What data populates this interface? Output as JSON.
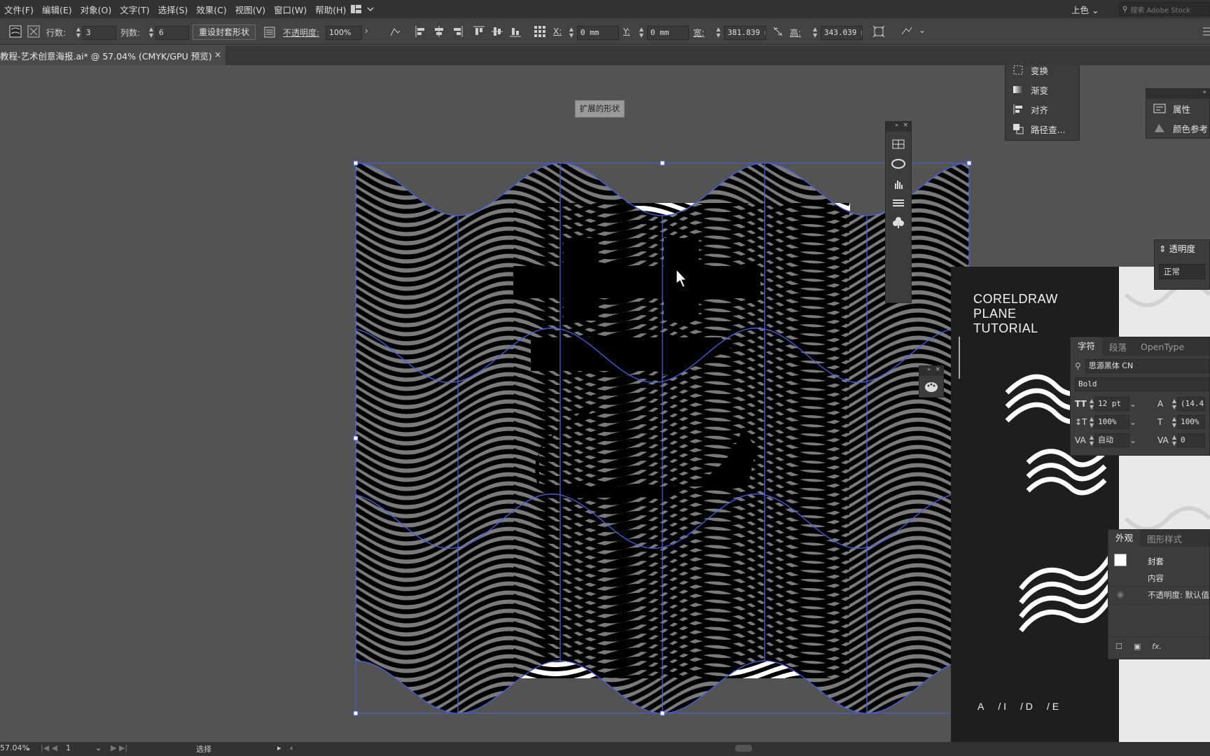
{
  "menu": [
    "文件(F)",
    "编辑(E)",
    "对象(O)",
    "文字(T)",
    "选择(S)",
    "效果(C)",
    "视图(V)",
    "窗口(W)",
    "帮助(H)"
  ],
  "menu_right": {
    "workspace": "上色",
    "search_placeholder": "搜索 Adobe Stock"
  },
  "control": {
    "rows_label": "行数:",
    "rows_value": "3",
    "cols_label": "列数:",
    "cols_value": "6",
    "reset_envelope": "重设封套形状",
    "opacity_label": "不透明度:",
    "opacity_value": "100%",
    "x_label": "X:",
    "x_value": "0 mm",
    "y_label": "Y:",
    "y_value": "0 mm",
    "w_label": "宽:",
    "w_value": "381.839 m",
    "h_label": "高:",
    "h_value": "343.039 m"
  },
  "document_tab": {
    "title": "教程-艺术创意海报.ai* @ 57.04% (CMYK/GPU 预览)",
    "close": "×"
  },
  "tooltip": "扩展的形状",
  "artwork": {
    "glyph": "艺"
  },
  "panel_transform": {
    "items": [
      "变换",
      "渐变",
      "对齐",
      "路径查..."
    ]
  },
  "panel_props": {
    "items": [
      "属性",
      "颜色参考"
    ]
  },
  "poster": {
    "title_lines": [
      "CORELDRAW",
      "PLANE",
      "TUTORIAL"
    ],
    "footer": [
      "A",
      "I",
      "D",
      "E"
    ]
  },
  "transparency": {
    "title": "透明度",
    "mode": "正常"
  },
  "character": {
    "tabs": [
      "字符",
      "段落",
      "OpenType"
    ],
    "font": "思源黑体 CN",
    "style": "Bold",
    "size": "12 pt",
    "leading": "(14.4",
    "vscale": "100%",
    "hscale": "100%",
    "kerning": "自动",
    "tracking": "0"
  },
  "appearance": {
    "tabs": [
      "外观",
      "图形样式"
    ],
    "items": [
      "封套",
      "内容",
      "不透明度: 默认值"
    ],
    "fx": "fx."
  },
  "status": {
    "zoom": "57.04%",
    "artboard": "1",
    "tool": "选择"
  },
  "colors": {
    "chrome": "#323232",
    "panel": "#3c3c3c",
    "canvas": "#535353",
    "selection": "#4a5fe0"
  }
}
